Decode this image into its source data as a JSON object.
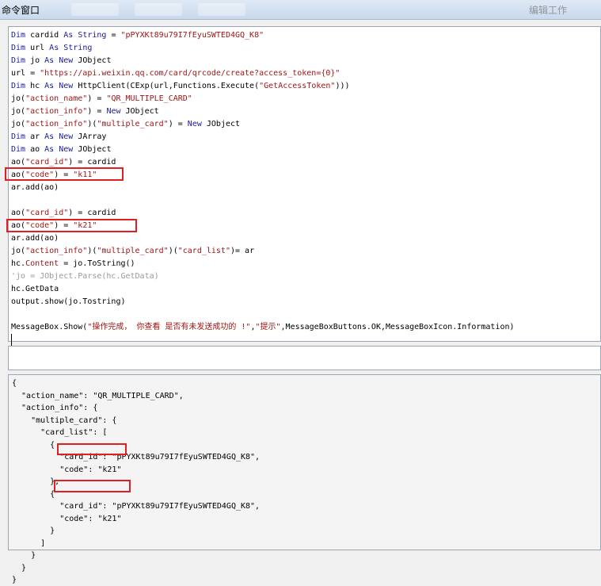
{
  "window": {
    "title": "命令窗口",
    "right_title": "编辑工作"
  },
  "code_lines": [
    [
      [
        "kw",
        "Dim"
      ],
      [
        "t",
        " cardid "
      ],
      [
        "kw",
        "As"
      ],
      [
        "t",
        " "
      ],
      [
        "kw",
        "String"
      ],
      [
        "t",
        " = "
      ],
      [
        "str",
        "\"pPYXKt89u79I7fEyuSWTED4GQ_K8\""
      ]
    ],
    [
      [
        "kw",
        "Dim"
      ],
      [
        "t",
        " url "
      ],
      [
        "kw",
        "As"
      ],
      [
        "t",
        " "
      ],
      [
        "kw",
        "String"
      ]
    ],
    [
      [
        "kw",
        "Dim"
      ],
      [
        "t",
        " jo "
      ],
      [
        "kw",
        "As"
      ],
      [
        "t",
        " "
      ],
      [
        "kw",
        "New"
      ],
      [
        "t",
        " JObject"
      ]
    ],
    [
      [
        "t",
        "url = "
      ],
      [
        "str",
        "\"https://api.weixin.qq.com/card/qrcode/create?access_token={0}\""
      ]
    ],
    [
      [
        "kw",
        "Dim"
      ],
      [
        "t",
        " hc "
      ],
      [
        "kw",
        "As"
      ],
      [
        "t",
        " "
      ],
      [
        "kw",
        "New"
      ],
      [
        "t",
        " HttpClient(CExp(url,Functions.Execute("
      ],
      [
        "str",
        "\"GetAccessToken\""
      ],
      [
        "t",
        ")))"
      ]
    ],
    [
      [
        "t",
        "jo("
      ],
      [
        "str",
        "\"action_name\""
      ],
      [
        "t",
        ") = "
      ],
      [
        "str",
        "\"QR_MULTIPLE_CARD\""
      ]
    ],
    [
      [
        "t",
        "jo("
      ],
      [
        "str",
        "\"action_info\""
      ],
      [
        "t",
        ") = "
      ],
      [
        "kw",
        "New"
      ],
      [
        "t",
        " JObject"
      ]
    ],
    [
      [
        "t",
        "jo("
      ],
      [
        "str",
        "\"action_info\""
      ],
      [
        "t",
        ")("
      ],
      [
        "str",
        "\"multiple_card\""
      ],
      [
        "t",
        ") = "
      ],
      [
        "kw",
        "New"
      ],
      [
        "t",
        " JObject"
      ]
    ],
    [
      [
        "kw",
        "Dim"
      ],
      [
        "t",
        " ar "
      ],
      [
        "kw",
        "As"
      ],
      [
        "t",
        " "
      ],
      [
        "kw",
        "New"
      ],
      [
        "t",
        " JArray"
      ]
    ],
    [
      [
        "kw",
        "Dim"
      ],
      [
        "t",
        " ao "
      ],
      [
        "kw",
        "As"
      ],
      [
        "t",
        " "
      ],
      [
        "kw",
        "New"
      ],
      [
        "t",
        " JObject"
      ]
    ],
    [
      [
        "t",
        "ao("
      ],
      [
        "str",
        "\"card_id\""
      ],
      [
        "t",
        ") = cardid"
      ]
    ],
    [
      [
        "t",
        "ao("
      ],
      [
        "str",
        "\"code\""
      ],
      [
        "t",
        ") = "
      ],
      [
        "str",
        "\"k11\""
      ]
    ],
    [
      [
        "t",
        "ar.add(ao)"
      ]
    ],
    [],
    [
      [
        "t",
        "ao("
      ],
      [
        "str",
        "\"card_id\""
      ],
      [
        "t",
        ") = cardid"
      ]
    ],
    [
      [
        "t",
        "ao("
      ],
      [
        "str",
        "\"code\""
      ],
      [
        "t",
        ") = "
      ],
      [
        "str",
        "\"k21\""
      ]
    ],
    [
      [
        "t",
        "ar.add(ao)"
      ]
    ],
    [
      [
        "t",
        "jo("
      ],
      [
        "str",
        "\"action_info\""
      ],
      [
        "t",
        ")("
      ],
      [
        "str",
        "\"multiple_card\""
      ],
      [
        "t",
        ")("
      ],
      [
        "str",
        "\"card_list\""
      ],
      [
        "t",
        ")= ar"
      ]
    ],
    [
      [
        "t",
        "hc."
      ],
      [
        "str",
        "Content"
      ],
      [
        "t",
        " = jo.ToString()"
      ]
    ],
    [
      [
        "cmt",
        "'jo = JObject.Parse(hc.GetData)"
      ]
    ],
    [
      [
        "t",
        "hc.GetData"
      ]
    ],
    [
      [
        "t",
        "output.show(jo.Tostring)"
      ]
    ],
    [],
    [
      [
        "t",
        "MessageBox.Show("
      ],
      [
        "str",
        "\"操作完成， 你查看 是否有未发送成功的 !\""
      ],
      [
        "t",
        ","
      ],
      [
        "str",
        "\"提示\""
      ],
      [
        "t",
        ",MessageBoxButtons.OK,MessageBoxIcon.Information)"
      ]
    ]
  ],
  "output_lines": [
    "{",
    "  \"action_name\": \"QR_MULTIPLE_CARD\",",
    "  \"action_info\": {",
    "    \"multiple_card\": {",
    "      \"card_list\": [",
    "        {",
    "          \"card_id\": \"pPYXKt89u79I7fEyuSWTED4GQ_K8\",",
    "          \"code\": \"k21\"",
    "        },",
    "        {",
    "          \"card_id\": \"pPYXKt89u79I7fEyuSWTED4GQ_K8\",",
    "          \"code\": \"k21\"",
    "        }",
    "      ]",
    "    }",
    "  }",
    "}"
  ],
  "colors": {
    "keyword": "#1a1aa6",
    "string": "#a31515",
    "comment": "#9a9a9a",
    "highlight": "#e02020"
  }
}
